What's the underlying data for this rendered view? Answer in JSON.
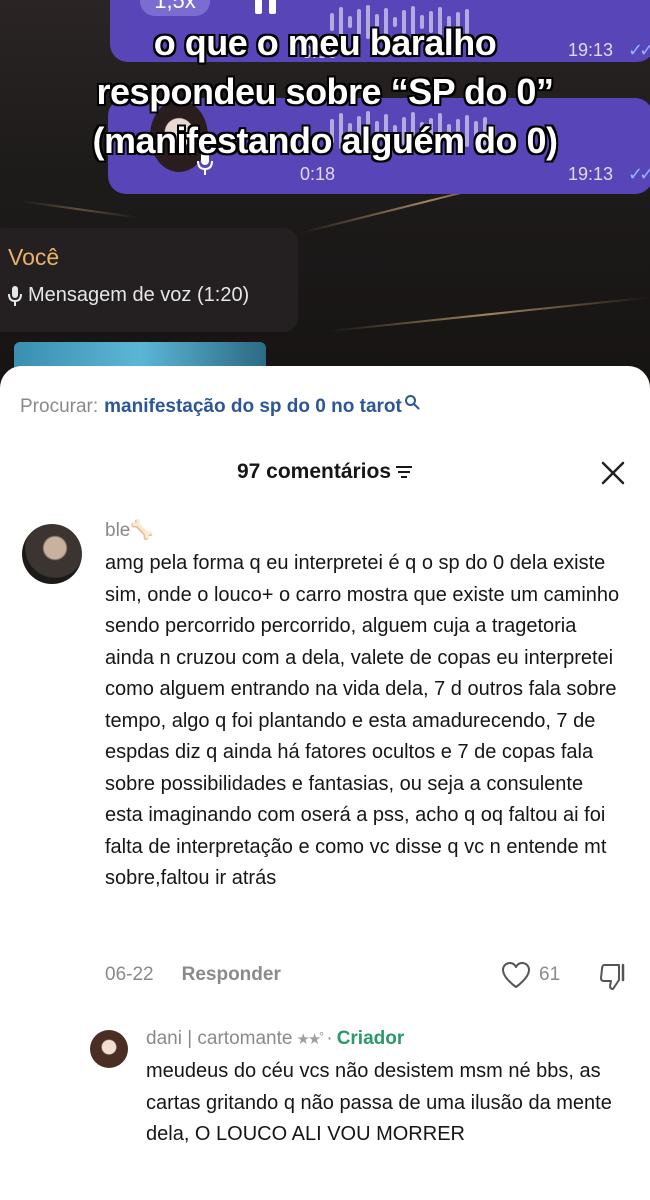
{
  "video": {
    "speed_label": "1,5x",
    "bubble1_duration": "0:38",
    "bubble1_time": "19:13",
    "bubble2_duration": "0:18",
    "bubble2_time": "19:13",
    "overlay_caption_lines": [
      "o que o meu baralho",
      "respondeu sobre “SP do 0”",
      "(manifestando alguém do 0)"
    ],
    "message_author": "Você",
    "message_voice": "Mensagem de voz (1:20)"
  },
  "sheet": {
    "search_prefix": "Procurar:",
    "search_query": "manifestação do sp do 0 no tarot",
    "comments_title": "97 comentários"
  },
  "comments": [
    {
      "username": "ble🦴",
      "text": "amg pela forma q eu interpretei é q o sp do 0 dela existe sim, onde o louco+ o carro mostra que existe um caminho sendo percorrido percorrido, alguem cuja a tragetoria ainda n cruzou com a dela, valete de copas eu interpretei como alguem entrando na vida dela, 7 d outros fala sobre tempo, algo q foi plantando e esta amadurecendo, 7 de espdas diz q ainda há fatores ocultos e 7 de copas fala sobre possibilidades e fantasias, ou seja a consulente esta imaginando com oserá a pss, acho q oq faltou ai foi falta de interpretação e como vc disse q vc n entende mt sobre,faltou ir atrás",
      "date": "06-22",
      "reply_label": "Responder",
      "likes": "61"
    }
  ],
  "reply": {
    "username": "dani | cartomante",
    "stars": "★★˚",
    "separator": "·",
    "badge": "Criador",
    "text": "meudeus do céu vcs não desistem msm né bbs, as cartas gritando q não passa de uma ilusão da mente dela, O LOUCO ALI VOU MORRER"
  },
  "colors": {
    "bubble": "#5846b8",
    "link": "#2b5797",
    "creator": "#2a9a6a",
    "muted": "#8a8a8a"
  }
}
